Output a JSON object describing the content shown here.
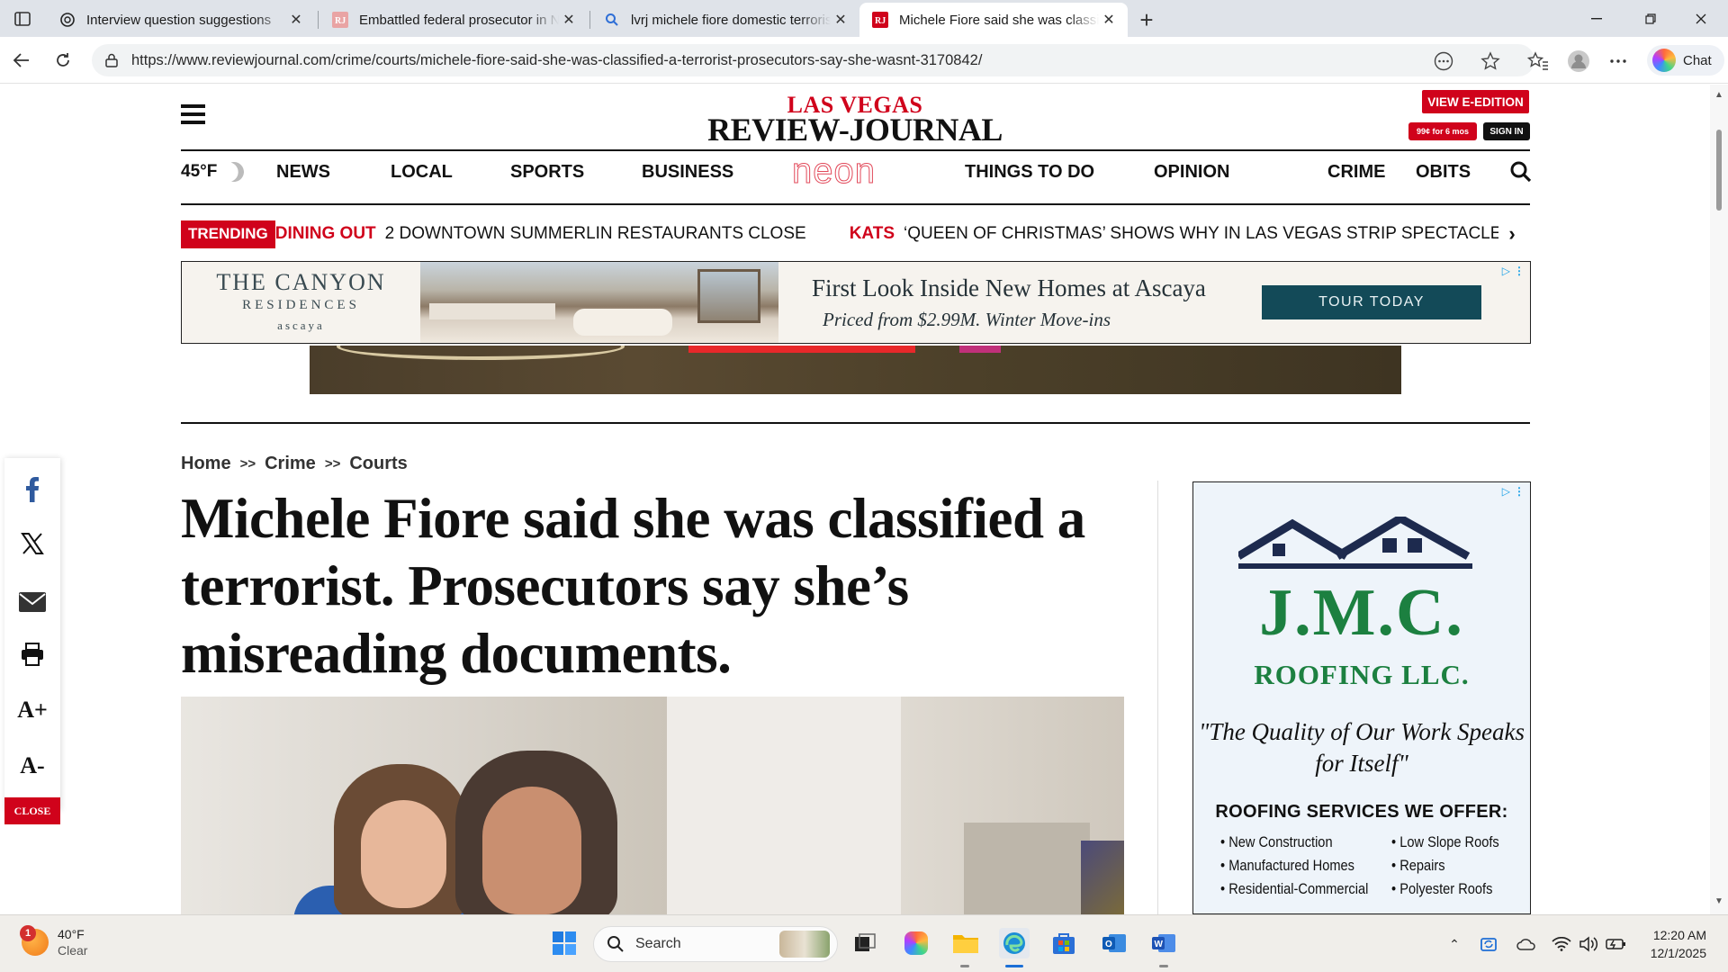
{
  "browser": {
    "tabs": [
      {
        "title": "Interview question suggestions",
        "icon": "openai-icon",
        "active": false
      },
      {
        "title": "Embattled federal prosecutor in Nevada",
        "icon": "rj-favicon",
        "active": false
      },
      {
        "title": "lvrj michele fiore domestic terrorist",
        "icon": "search-icon",
        "active": false
      },
      {
        "title": "Michele Fiore said she was classified",
        "icon": "rj-favicon",
        "active": true
      }
    ],
    "url": "https://www.reviewjournal.com/crime/courts/michele-fiore-said-she-was-classified-a-terrorist-prosecutors-say-she-wasnt-3170842/",
    "chat_label": "Chat"
  },
  "site": {
    "logo_top": "LAS VEGAS",
    "logo_bottom": "REVIEW-JOURNAL",
    "eedition_label": "VIEW E-EDITION",
    "promo_label": "99¢ for 6 mos",
    "signin_label": "SIGN IN",
    "temperature": "45°F",
    "nav": [
      "NEWS",
      "LOCAL",
      "SPORTS",
      "BUSINESS",
      "neon",
      "THINGS TO DO",
      "OPINION",
      "CRIME",
      "OBITS"
    ],
    "trending_label": "TRENDING",
    "trending": [
      {
        "category": "DINING OUT",
        "headline": "2 DOWNTOWN SUMMERLIN RESTAURANTS CLOSE"
      },
      {
        "category": "KATS",
        "headline": "‘QUEEN OF CHRISTMAS’ SHOWS WHY IN LAS VEGAS STRIP SPECTACLE"
      }
    ]
  },
  "top_ad": {
    "brand_line1": "THE CANYON",
    "brand_line2": "RESIDENCES",
    "brand_line3": "ascaya",
    "headline": "First Look Inside New Homes at Ascaya",
    "subline": "Priced from $2.99M. Winter Move-ins",
    "cta": "TOUR TODAY"
  },
  "share": {
    "close_label": "CLOSE",
    "increase_label": "A+",
    "decrease_label": "A-"
  },
  "article": {
    "breadcrumb": [
      "Home",
      "Crime",
      "Courts"
    ],
    "breadcrumb_sep": ">>",
    "headline": "Michele Fiore said she was classified a terrorist. Prosecutors say she’s misreading documents."
  },
  "side_ad": {
    "company": "J.M.C.",
    "company_sub": "ROOFING LLC.",
    "quote": "\"The Quality of Our Work Speaks for Itself\"",
    "services_title": "ROOFING SERVICES WE OFFER:",
    "services": [
      "New Construction",
      "Low Slope Roofs",
      "Manufactured Homes",
      "Repairs",
      "Residential-Commercial",
      "Polyester Roofs"
    ]
  },
  "taskbar": {
    "weather_temp": "40°F",
    "weather_desc": "Clear",
    "weather_badge": "1",
    "search_placeholder": "Search",
    "time": "12:20 AM",
    "date": "12/1/2025"
  },
  "colors": {
    "brand_red": "#d0021b",
    "neon_pink": "#e2495a",
    "ad_teal": "#134a58",
    "roof_green": "#1c8040"
  }
}
